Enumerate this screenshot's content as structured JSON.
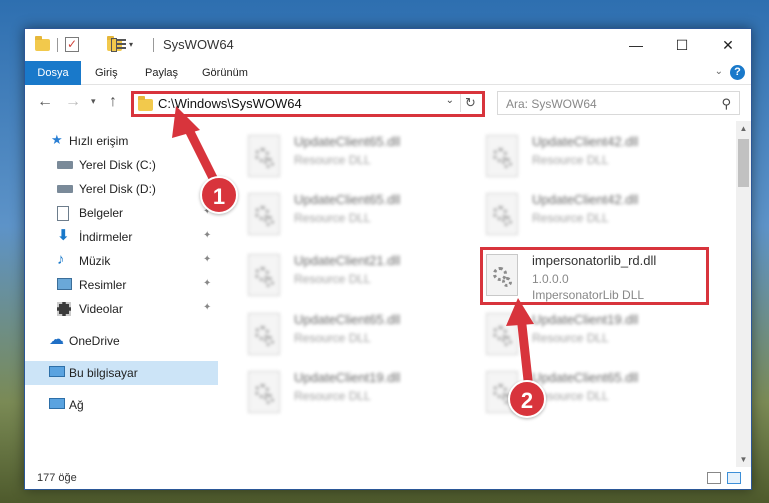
{
  "window": {
    "title": "SysWOW64",
    "controls": {
      "minimize": "—",
      "maximize": "☐",
      "close": "✕"
    }
  },
  "ribbon": {
    "tabs": [
      "Dosya",
      "Giriş",
      "Paylaş",
      "Görünüm"
    ],
    "help": "?"
  },
  "nav": {
    "address": "C:\\Windows\\SysWOW64",
    "search_placeholder": "Ara: SysWOW64"
  },
  "sidebar": {
    "items": [
      {
        "label": "Hızlı erişim",
        "icon": "star-icon",
        "pinned": false
      },
      {
        "label": "Yerel Disk (C:)",
        "icon": "drive-icon",
        "pinned": true
      },
      {
        "label": "Yerel Disk (D:)",
        "icon": "drive-icon",
        "pinned": true
      },
      {
        "label": "Belgeler",
        "icon": "documents-icon",
        "pinned": true
      },
      {
        "label": "İndirmeler",
        "icon": "download-icon",
        "pinned": true
      },
      {
        "label": "Müzik",
        "icon": "music-icon",
        "pinned": true
      },
      {
        "label": "Resimler",
        "icon": "pictures-icon",
        "pinned": true
      },
      {
        "label": "Videolar",
        "icon": "video-icon",
        "pinned": true
      },
      {
        "label": "OneDrive",
        "icon": "cloud-icon",
        "pinned": false
      },
      {
        "label": "Bu bilgisayar",
        "icon": "computer-icon",
        "pinned": false,
        "selected": true
      },
      {
        "label": "Ağ",
        "icon": "network-icon",
        "pinned": false
      }
    ]
  },
  "files": [
    {
      "name": "UpdateClient65.dll",
      "line2": "Resource DLL",
      "blurred": true
    },
    {
      "name": "UpdateClient42.dll",
      "line2": "Resource DLL",
      "blurred": true
    },
    {
      "name": "UpdateClient65.dll",
      "line2": "Resource DLL",
      "blurred": true
    },
    {
      "name": "UpdateClient42.dll",
      "line2": "Resource DLL",
      "blurred": true
    },
    {
      "name": "UpdateClient21.dll",
      "line2": "Resource DLL",
      "blurred": true
    },
    {
      "name": "impersonatorlib_rd.dll",
      "line2": "1.0.0.0",
      "line3": "ImpersonatorLib DLL",
      "blurred": false
    },
    {
      "name": "UpdateClient65.dll",
      "line2": "Resource DLL",
      "blurred": true
    },
    {
      "name": "UpdateClient19.dll",
      "line2": "Resource DLL",
      "blurred": true
    },
    {
      "name": "UpdateClient19.dll",
      "line2": "Resource DLL",
      "blurred": true
    },
    {
      "name": "UpdateClient65.dll",
      "line2": "Resource DLL",
      "blurred": true
    }
  ],
  "status": {
    "item_count": "177 öğe"
  },
  "annotations": {
    "step1": "1",
    "step2": "2",
    "color": "#d8343c"
  },
  "colors": {
    "accent": "#1979ca",
    "selected": "#cce4f7"
  }
}
